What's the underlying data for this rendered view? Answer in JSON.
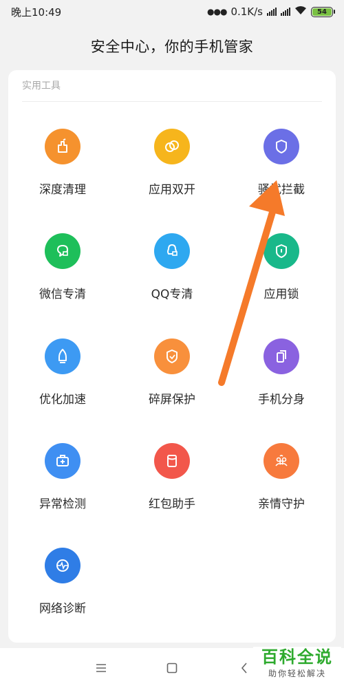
{
  "status": {
    "time": "晚上10:49",
    "speed": "0.1K/s",
    "battery": "54"
  },
  "title": "安全中心，你的手机管家",
  "section": {
    "header": "实用工具",
    "tools": [
      {
        "label": "深度清理",
        "icon": "broom-icon",
        "color": "#f5922e"
      },
      {
        "label": "应用双开",
        "icon": "dual-circles-icon",
        "color": "#f6b51c"
      },
      {
        "label": "骚扰拦截",
        "icon": "shield-icon",
        "color": "#6b6fe6"
      },
      {
        "label": "微信专清",
        "icon": "wechat-clean-icon",
        "color": "#1ebf5a"
      },
      {
        "label": "QQ专清",
        "icon": "qq-clean-icon",
        "color": "#2ea8f0"
      },
      {
        "label": "应用锁",
        "icon": "lock-shield-icon",
        "color": "#19b88a"
      },
      {
        "label": "优化加速",
        "icon": "rocket-icon",
        "color": "#3d9af3"
      },
      {
        "label": "碎屏保护",
        "icon": "screen-shield-icon",
        "color": "#f8903c"
      },
      {
        "label": "手机分身",
        "icon": "phone-clone-icon",
        "color": "#8a62e0"
      },
      {
        "label": "异常检测",
        "icon": "medkit-icon",
        "color": "#3f8ff2"
      },
      {
        "label": "红包助手",
        "icon": "red-envelope-icon",
        "color": "#f2574b"
      },
      {
        "label": "亲情守护",
        "icon": "family-icon",
        "color": "#f77a3d"
      },
      {
        "label": "网络诊断",
        "icon": "network-pulse-icon",
        "color": "#2f7de6"
      }
    ]
  },
  "nav": {
    "menu": "menu-icon",
    "home": "home-icon",
    "back": "back-icon"
  },
  "watermark": {
    "main": "百科全说",
    "sub": "助你轻松解决"
  },
  "annotation": {
    "arrow_color": "#f57a2a"
  }
}
